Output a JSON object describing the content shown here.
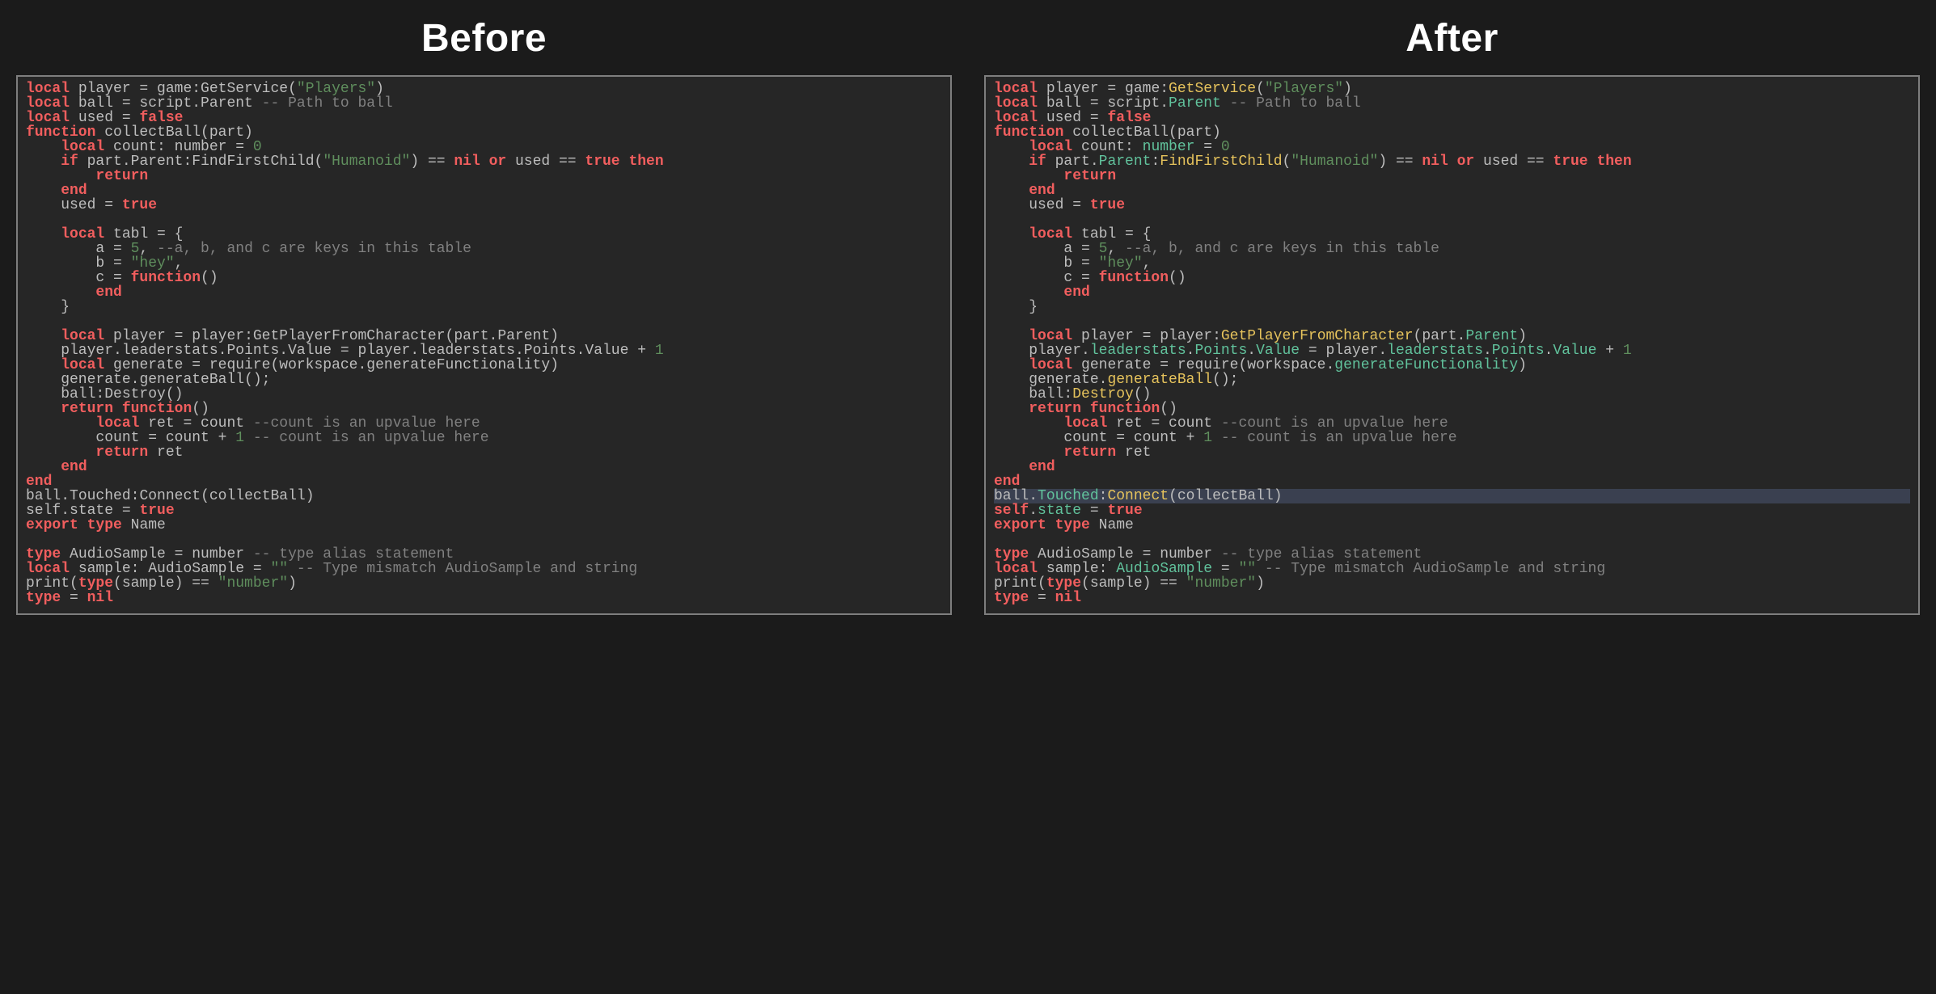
{
  "headings": {
    "before": "Before",
    "after": "After"
  },
  "code": [
    "local player = game:GetService(\"Players\")",
    "local ball = script.Parent -- Path to ball",
    "local used = false",
    "function collectBall(part)",
    "    local count: number = 0",
    "    if part.Parent:FindFirstChild(\"Humanoid\") == nil or used == true then",
    "        return",
    "    end",
    "    used = true",
    "",
    "    local tabl = {",
    "        a = 5, --a, b, and c are keys in this table",
    "        b = \"hey\",",
    "        c = function()",
    "        end",
    "    }",
    "",
    "    local player = player:GetPlayerFromCharacter(part.Parent)",
    "    player.leaderstats.Points.Value = player.leaderstats.Points.Value + 1",
    "    local generate = require(workspace.generateFunctionality)",
    "    generate.generateBall();",
    "    ball:Destroy()",
    "    return function()",
    "        local ret = count --count is an upvalue here",
    "        count = count + 1 -- count is an upvalue here",
    "        return ret",
    "    end",
    "end",
    "ball.Touched:Connect(collectBall)",
    "self.state = true",
    "export type Name",
    "",
    "type AudioSample = number -- type alias statement",
    "local sample: AudioSample = \"\" -- Type mismatch AudioSample and string",
    "print(type(sample) == \"number\")",
    "type = nil"
  ],
  "after_highlight_line": 28,
  "colors": {
    "bg": "#1b1b1b",
    "panel": "#262626",
    "border": "#7e7e7e",
    "text": "#bdbdbd",
    "keyword": "#f15e5e",
    "string": "#5f8e5d",
    "comment": "#808080",
    "after_property": "#61c29c",
    "after_function": "#e6c35c",
    "after_self": "#f15e5e",
    "line_highlight": "#3a4050"
  }
}
